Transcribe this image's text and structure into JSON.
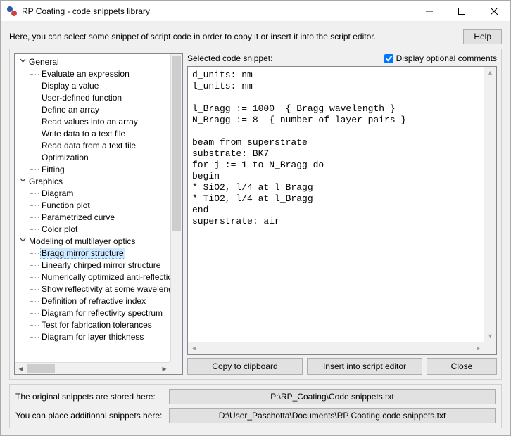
{
  "window": {
    "title": "RP Coating - code snippets library"
  },
  "intro": "Here, you can select some snippet of script code in order to copy it or insert it into the script editor.",
  "help_label": "Help",
  "tree": {
    "groups": [
      {
        "label": "General",
        "items": [
          "Evaluate an expression",
          "Display a value",
          "User-defined function",
          "Define an array",
          "Read values into an array",
          "Write data to a text file",
          "Read data from a text file",
          "Optimization",
          "Fitting"
        ]
      },
      {
        "label": "Graphics",
        "items": [
          "Diagram",
          "Function plot",
          "Parametrized curve",
          "Color plot"
        ]
      },
      {
        "label": "Modeling of multilayer optics",
        "items": [
          "Bragg mirror structure",
          "Linearly chirped mirror structure",
          "Numerically optimized anti-reflection",
          "Show reflectivity at some wavelength",
          "Definition of refractive index",
          "Diagram for reflectivity spectrum",
          "Test for fabrication tolerances",
          "Diagram for layer thickness"
        ]
      }
    ],
    "selected": "Bragg mirror structure"
  },
  "right": {
    "label": "Selected code snippet:",
    "checkbox_label": "Display optional comments",
    "checkbox_checked": true,
    "code": "d_units: nm\nl_units: nm\n\nl_Bragg := 1000  { Bragg wavelength }\nN_Bragg := 8  { number of layer pairs }\n\nbeam from superstrate\nsubstrate: BK7\nfor j := 1 to N_Bragg do\nbegin\n* SiO2, l/4 at l_Bragg\n* TiO2, l/4 at l_Bragg\nend\nsuperstrate: air"
  },
  "buttons": {
    "copy": "Copy to clipboard",
    "insert": "Insert into script editor",
    "close": "Close"
  },
  "footer": {
    "label1": "The original snippets are stored here:",
    "path1": "P:\\RP_Coating\\Code snippets.txt",
    "label2": "You can place additional snippets here:",
    "path2": "D:\\User_Paschotta\\Documents\\RP Coating code snippets.txt"
  }
}
